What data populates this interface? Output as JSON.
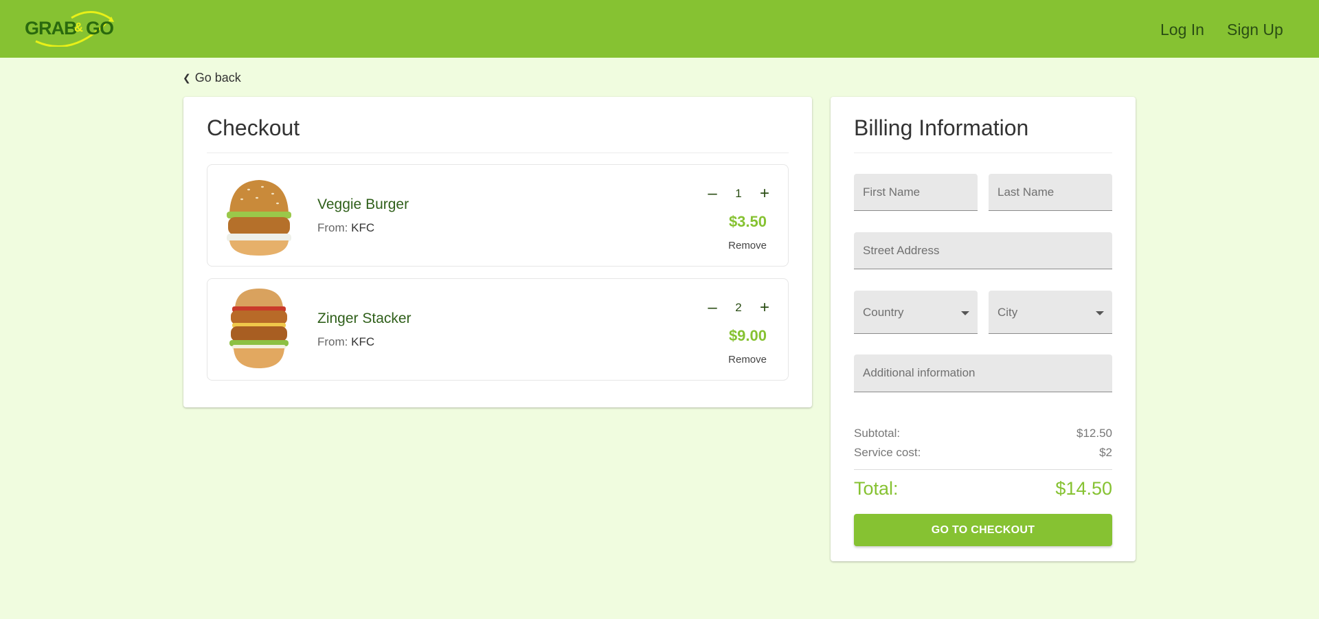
{
  "header": {
    "logo_text": "GRAB&GO",
    "login_label": "Log In",
    "signup_label": "Sign Up"
  },
  "nav": {
    "go_back_label": "Go back"
  },
  "checkout": {
    "title": "Checkout",
    "from_label": "From:",
    "remove_label": "Remove",
    "items": [
      {
        "name": "Veggie Burger",
        "vendor": "KFC",
        "quantity": "1",
        "price": "$3.50"
      },
      {
        "name": "Zinger Stacker",
        "vendor": "KFC",
        "quantity": "2",
        "price": "$9.00"
      }
    ]
  },
  "billing": {
    "title": "Billing Information",
    "first_name_placeholder": "First Name",
    "last_name_placeholder": "Last Name",
    "street_placeholder": "Street Address",
    "country_label": "Country",
    "city_label": "City",
    "additional_placeholder": "Additional information",
    "subtotal_label": "Subtotal:",
    "subtotal_value": "$12.50",
    "service_label": "Service cost:",
    "service_value": "$2",
    "total_label": "Total:",
    "total_value": "$14.50",
    "checkout_button": "GO TO CHECKOUT"
  },
  "colors": {
    "brand_green": "#86c232",
    "background": "#f0fcdf",
    "dark_green": "#2f5f1a"
  },
  "icons": [
    "chevron-left-icon",
    "minus-icon",
    "plus-icon",
    "caret-down-icon"
  ]
}
